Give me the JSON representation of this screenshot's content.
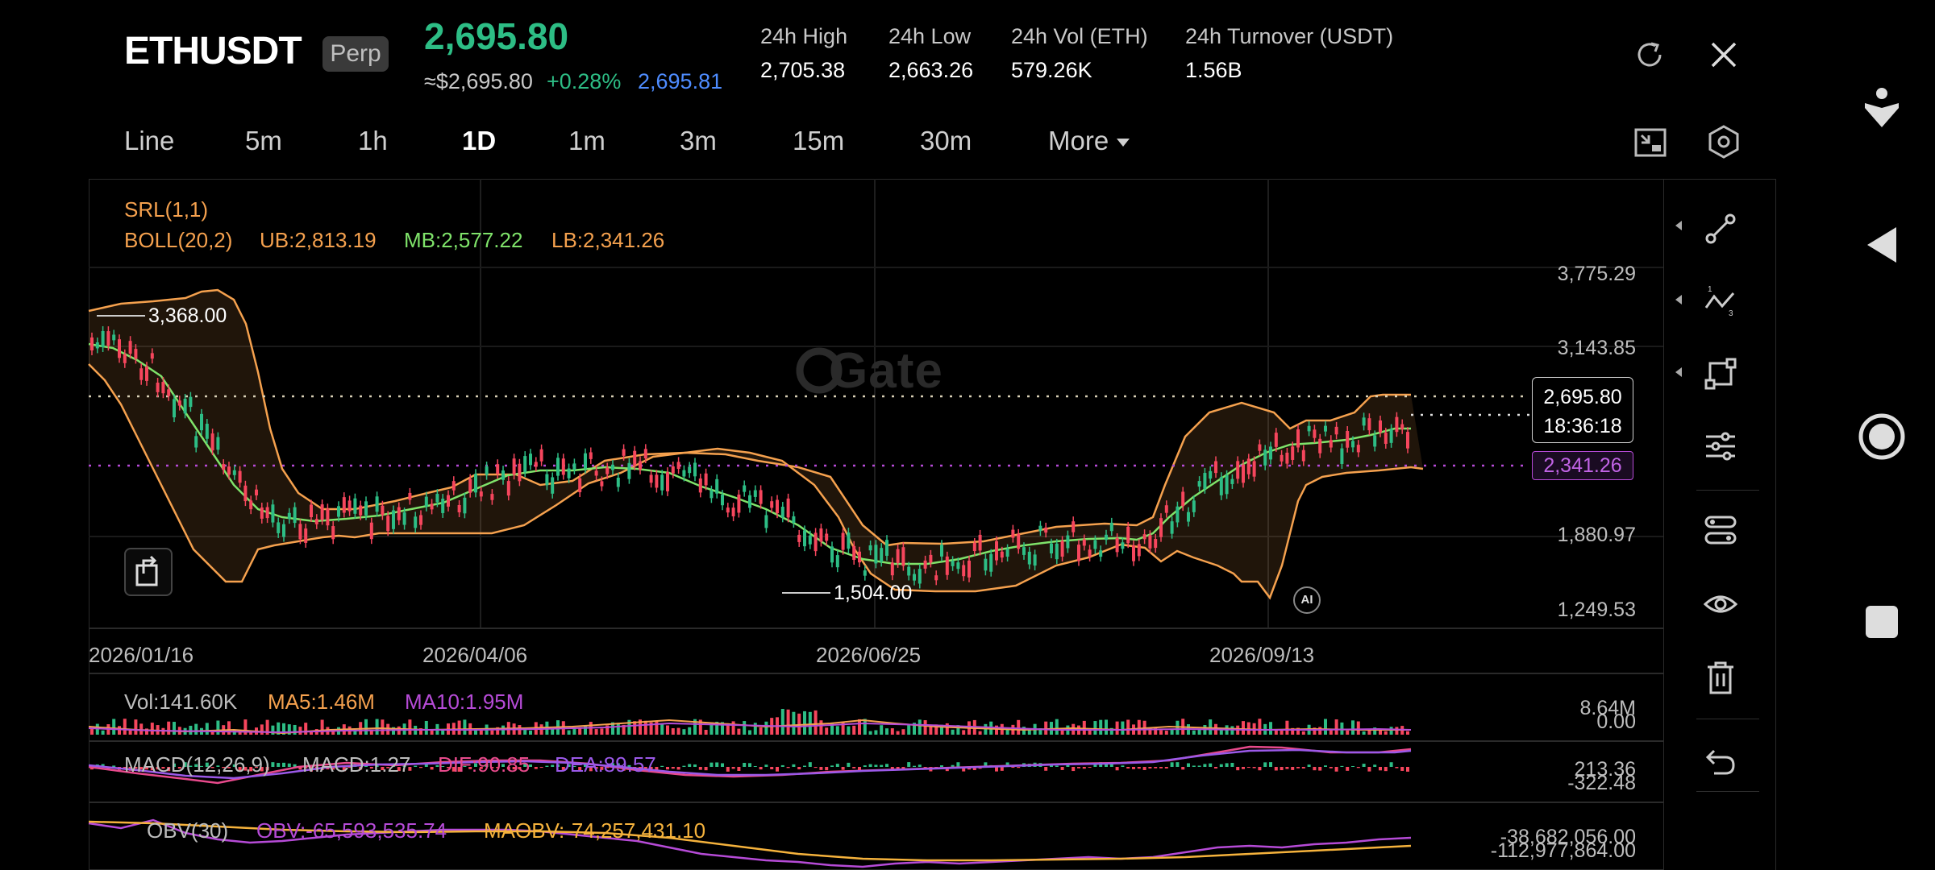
{
  "header": {
    "symbol": "ETHUSDT",
    "badge": "Perp",
    "last_price": "2,695.80",
    "approx_usd": "≈$2,695.80",
    "change_pct": "+0.28%",
    "mark_price": "2,695.81",
    "stats": [
      {
        "label": "24h High",
        "value": "2,705.38"
      },
      {
        "label": "24h Low",
        "value": "2,663.26"
      },
      {
        "label": "24h Vol (ETH)",
        "value": "579.26K"
      },
      {
        "label": "24h Turnover (USDT)",
        "value": "1.56B"
      }
    ]
  },
  "intervals": {
    "items": [
      "Line",
      "5m",
      "1h",
      "1D",
      "1m",
      "3m",
      "15m",
      "30m"
    ],
    "active": "1D",
    "more_label": "More"
  },
  "main_chart": {
    "indicator_srl": "SRL(1,1)",
    "boll_label": "BOLL(20,2)",
    "boll_ub": "UB:2,813.19",
    "boll_mb": "MB:2,577.22",
    "boll_lb": "LB:2,341.26",
    "price_axis": [
      "3,775.29",
      "3,143.85",
      "1,880.97",
      "1,249.53"
    ],
    "date_axis": [
      "2026/01/16",
      "2026/04/06",
      "2026/06/25",
      "2026/09/13"
    ],
    "high_marker": "3,368.00",
    "low_marker": "1,504.00",
    "current_price_tag": "2,695.80",
    "countdown_tag": "18:36:18",
    "lb_tag": "2,341.26",
    "watermark": "Gate",
    "ai_badge": "AI"
  },
  "volume_panel": {
    "vol": "Vol:141.60K",
    "ma5": "MA5:1.46M",
    "ma10": "MA10:1.95M",
    "axis_top": "8.64M",
    "axis_bottom": "0.00"
  },
  "macd_panel": {
    "label": "MACD(12,26,9)",
    "macd": "MACD:1.27",
    "dif": "DIF:90.85",
    "dea": "DEA:89.57",
    "axis_top": "213.36",
    "axis_bottom": "-322.48"
  },
  "obv_panel": {
    "label": "OBV(30)",
    "obv": "OBV:-65,593,535.74",
    "maobv": "MAOBV:-74,257,431.10",
    "axis_top": "-38,682,056.00",
    "axis_bottom": "-112,977,864.00"
  },
  "colors": {
    "up": "#2dbd85",
    "down": "#f6465d",
    "boll_band": "#f5a14e",
    "boll_mid": "#7fe36a",
    "lb_line": "#b64bd7"
  }
}
